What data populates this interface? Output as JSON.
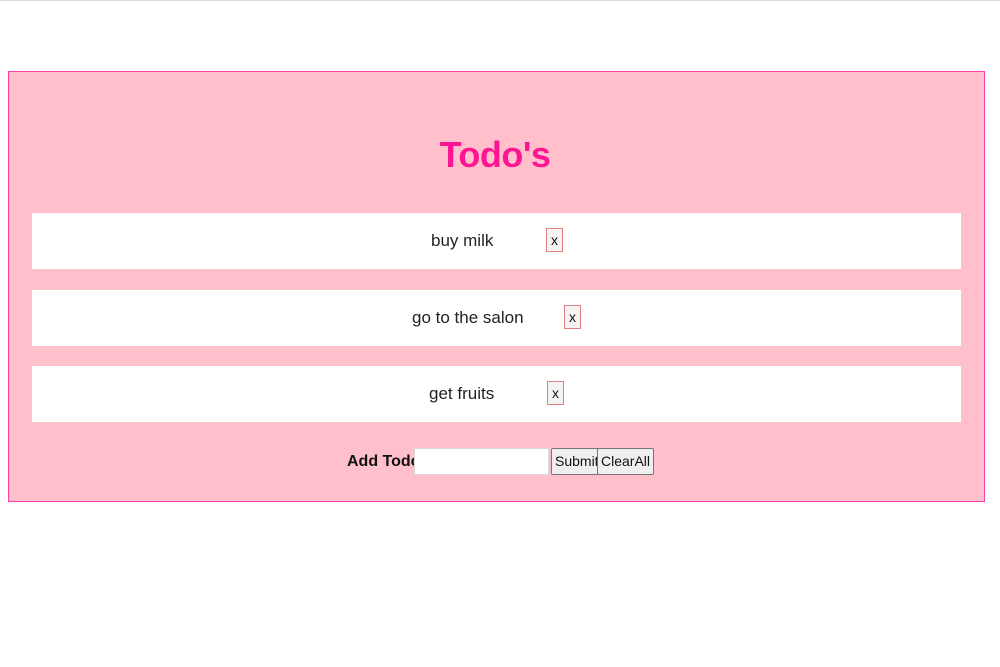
{
  "app": {
    "title": "Todo's",
    "accent_color": "#ff1493",
    "background_color": "#ffc0cb"
  },
  "todos": [
    {
      "text": "buy milk",
      "delete_label": "x"
    },
    {
      "text": "go to the salon",
      "delete_label": "x"
    },
    {
      "text": "get fruits",
      "delete_label": "x"
    }
  ],
  "form": {
    "label": "Add Todo:",
    "input_value": "",
    "submit_label": "Submit",
    "clear_label": "ClearAll"
  }
}
